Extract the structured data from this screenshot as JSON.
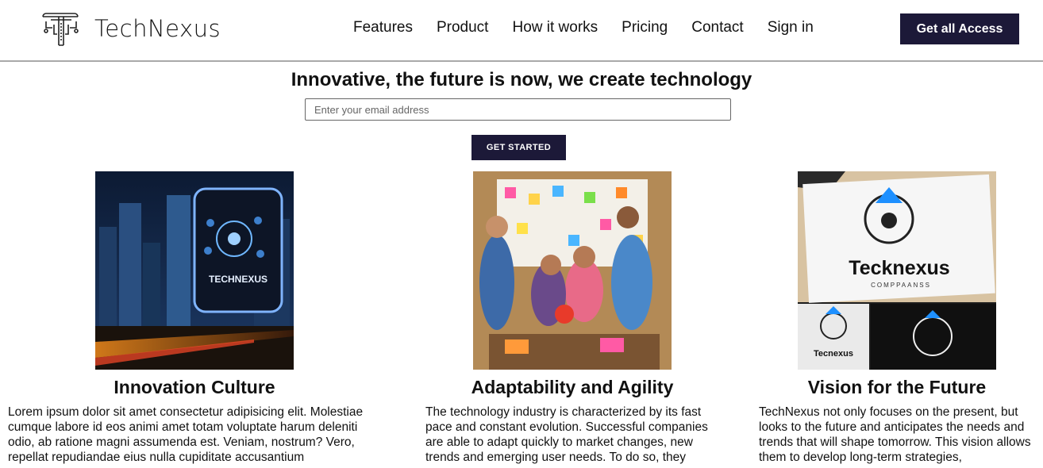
{
  "header": {
    "brand": "TechNexus",
    "logo_icon": "circuit-logo-icon",
    "nav": [
      "Features",
      "Product",
      "How it works",
      "Pricing",
      "Contact",
      "Sign in"
    ],
    "cta": "Get all Access"
  },
  "hero": {
    "title": "Innovative, the future is now, we create technology",
    "email_placeholder": "Enter your email address",
    "button": "GET STARTED"
  },
  "cards": [
    {
      "title": "Innovation Culture",
      "image": "city-billboard-image",
      "image_caption": "TECHNEXUS",
      "text": "Lorem ipsum dolor sit amet consectetur adipisicing elit. Molestiae cumque labore id eos animi amet totam voluptate harum deleniti odio, ab ratione magni assumenda est. Veniam, nostrum? Vero, repellat repudiandae eius nulla cupiditate accusantium"
    },
    {
      "title": "Adaptability and Agility",
      "image": "team-meeting-image",
      "text": "The technology industry is characterized by its fast pace and constant evolution. Successful companies are able to adapt quickly to market changes, new trends and emerging user needs. To do so, they"
    },
    {
      "title": "Vision for the Future",
      "image": "logo-mockup-image",
      "image_caption": "Tecknexus",
      "image_subcaption": "COMPPAANSS",
      "image_caption_small": "Tecnexus",
      "text": "TechNexus not only focuses on the present, but looks to the future and anticipates the needs and trends that will shape tomorrow. This vision allows them to develop long-term strategies,"
    }
  ],
  "colors": {
    "accent": "#1c1938",
    "divider": "#a9a9a9"
  }
}
